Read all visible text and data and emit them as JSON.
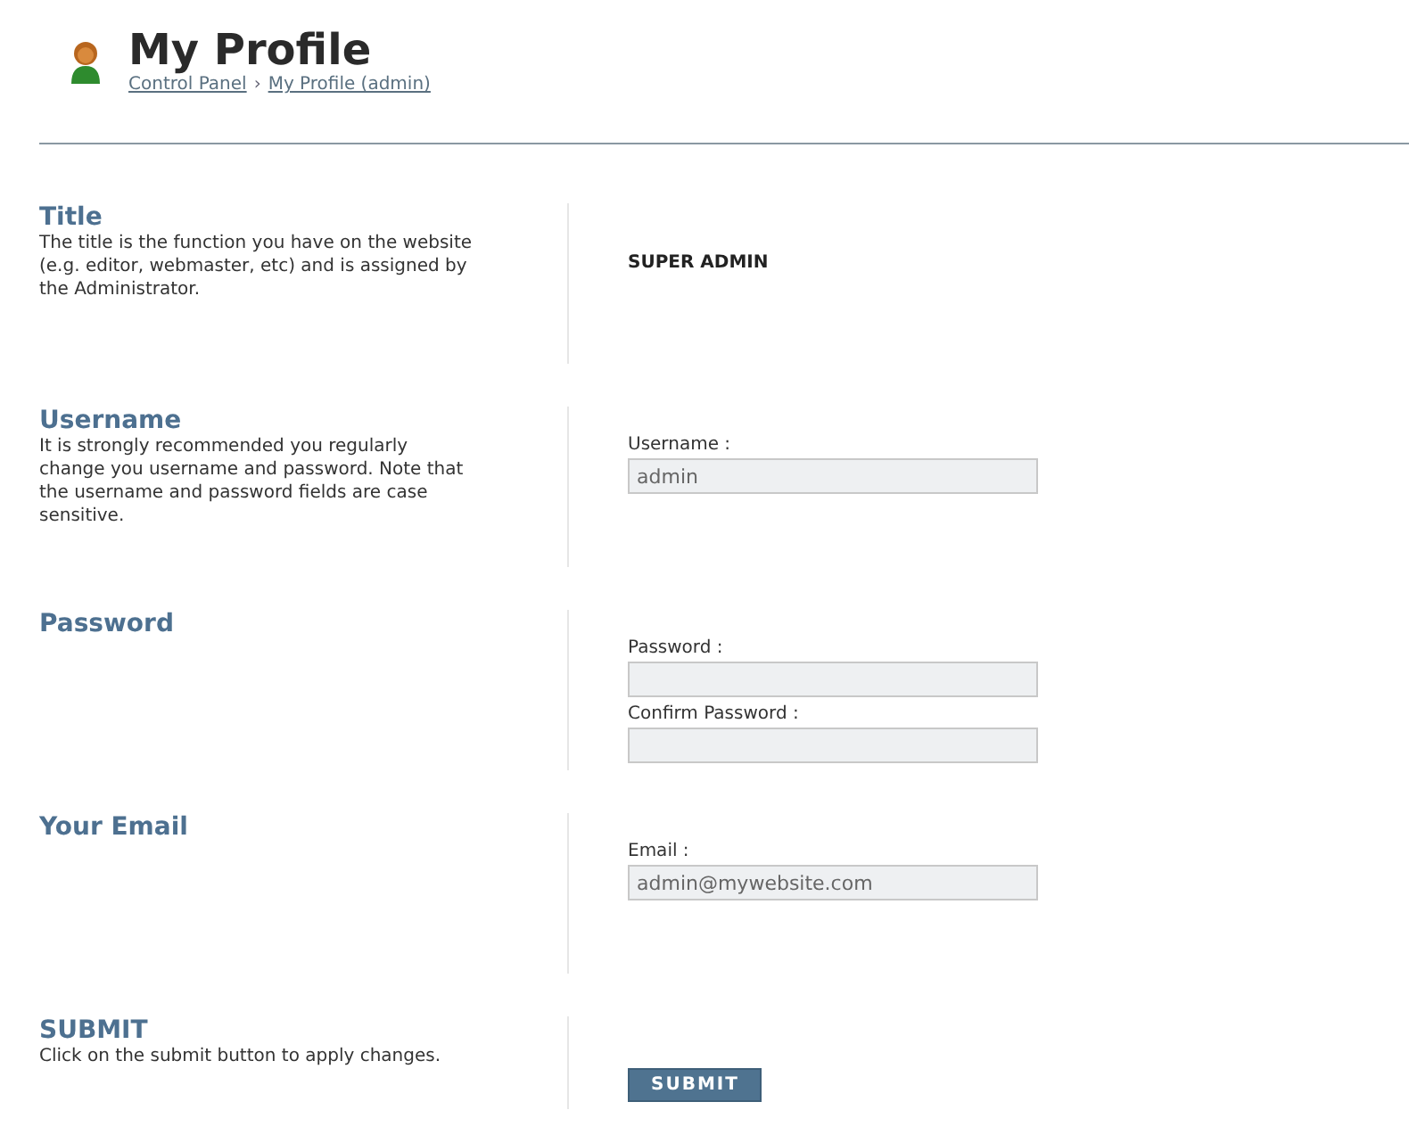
{
  "header": {
    "title": "My Profile",
    "breadcrumb": [
      "Control Panel",
      "My Profile (admin)"
    ],
    "separator": "›"
  },
  "sections": [
    {
      "kind": "value",
      "heading": "Title",
      "description": "The title is the function you have on the website (e.g. editor, webmaster, etc) and is assigned by the Administrator.",
      "value": "SUPER ADMIN"
    },
    {
      "kind": "fields",
      "heading": "Username",
      "description": "It is strongly recommended you regularly change you username and password. Note that the username and password fields are case sensitive.",
      "fields": [
        {
          "label": "Username :",
          "value": "admin"
        }
      ]
    },
    {
      "kind": "fields",
      "heading": "Password",
      "fields": [
        {
          "label": "Password :"
        },
        {
          "label": "Confirm Password :"
        }
      ]
    },
    {
      "kind": "fields",
      "heading": "Your Email",
      "fields": [
        {
          "label": "Email :",
          "value": "admin@mywebsite.com"
        }
      ]
    },
    {
      "kind": "button",
      "heading": "SUBMIT",
      "description": "Click on the submit button to apply changes.",
      "button": "SUBMIT"
    }
  ]
}
